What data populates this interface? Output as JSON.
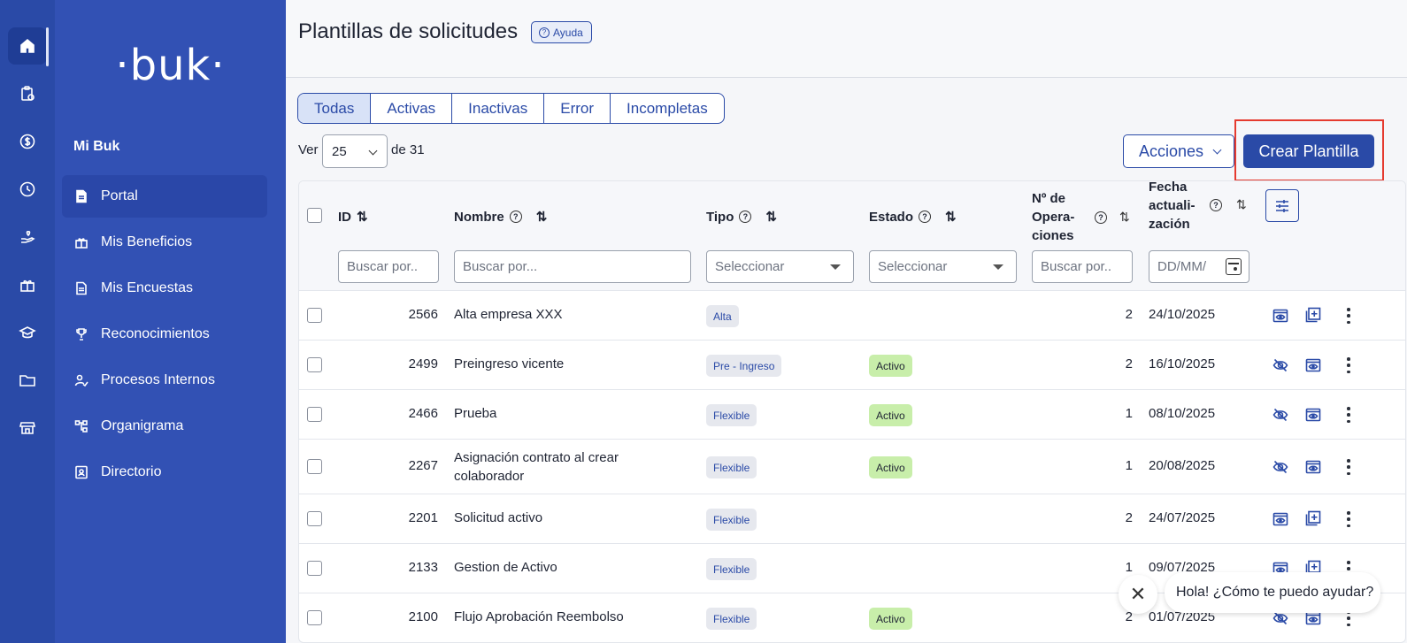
{
  "rail": {
    "items": [
      {
        "icon": "home-icon",
        "active": true
      },
      {
        "icon": "clipboard-clock-icon"
      },
      {
        "icon": "dollar-circle-icon"
      },
      {
        "icon": "clock-icon"
      },
      {
        "icon": "hand-heart-icon"
      },
      {
        "icon": "gift-icon"
      },
      {
        "icon": "graduation-cap-icon"
      },
      {
        "icon": "folder-icon"
      },
      {
        "icon": "store-icon"
      }
    ]
  },
  "sidebar": {
    "logo": "·buk·",
    "section_title": "Mi Buk",
    "items": [
      {
        "label": "Portal",
        "icon": "document-icon",
        "active": true
      },
      {
        "label": "Mis Beneficios",
        "icon": "gift-icon"
      },
      {
        "label": "Mis Encuestas",
        "icon": "survey-icon"
      },
      {
        "label": "Reconocimientos",
        "icon": "trophy-icon"
      },
      {
        "label": "Procesos Internos",
        "icon": "user-check-icon"
      },
      {
        "label": "Organigrama",
        "icon": "org-chart-icon"
      },
      {
        "label": "Directorio",
        "icon": "contact-card-icon"
      }
    ]
  },
  "header": {
    "title": "Plantillas de solicitudes",
    "help_label": "Ayuda"
  },
  "tabs": [
    {
      "label": "Todas",
      "active": true
    },
    {
      "label": "Activas"
    },
    {
      "label": "Inactivas"
    },
    {
      "label": "Error"
    },
    {
      "label": "Incompletas"
    }
  ],
  "pagination": {
    "ver_label": "Ver",
    "per_page": "25",
    "total_label": "de 31"
  },
  "toolbar": {
    "actions_label": "Acciones",
    "create_label": "Crear Plantilla"
  },
  "table": {
    "columns": {
      "id": "ID",
      "nombre": "Nombre",
      "tipo": "Tipo",
      "estado": "Estado",
      "operaciones": [
        "Nº de",
        "Opera-",
        "ciones"
      ],
      "fecha": [
        "Fecha",
        "actuali-",
        "zación"
      ]
    },
    "filters": {
      "id_placeholder": "Buscar por..",
      "nombre_placeholder": "Buscar por...",
      "tipo_placeholder": "Seleccionar",
      "estado_placeholder": "Seleccionar",
      "operaciones_placeholder": "Buscar por..",
      "fecha_placeholder": "DD/MM/"
    },
    "rows": [
      {
        "id": "2566",
        "nombre": "Alta empresa XXX",
        "tipo": "Alta",
        "estado": "",
        "operaciones": "2",
        "fecha": "24/10/2025",
        "icons": [
          "eye-window-icon",
          "add-square-icon"
        ]
      },
      {
        "id": "2499",
        "nombre": "Preingreso vicente",
        "tipo": "Pre - Ingreso",
        "estado": "Activo",
        "operaciones": "2",
        "fecha": "16/10/2025",
        "icons": [
          "eye-off-icon",
          "eye-window-icon"
        ]
      },
      {
        "id": "2466",
        "nombre": "Prueba",
        "tipo": "Flexible",
        "estado": "Activo",
        "operaciones": "1",
        "fecha": "08/10/2025",
        "icons": [
          "eye-off-icon",
          "eye-window-icon"
        ]
      },
      {
        "id": "2267",
        "nombre": "Asignación contrato al crear colaborador",
        "tipo": "Flexible",
        "estado": "Activo",
        "operaciones": "1",
        "fecha": "20/08/2025",
        "icons": [
          "eye-off-icon",
          "eye-window-icon"
        ]
      },
      {
        "id": "2201",
        "nombre": "Solicitud activo",
        "tipo": "Flexible",
        "estado": "",
        "operaciones": "2",
        "fecha": "24/07/2025",
        "icons": [
          "eye-window-icon",
          "add-square-icon"
        ]
      },
      {
        "id": "2133",
        "nombre": "Gestion de Activo",
        "tipo": "Flexible",
        "estado": "",
        "operaciones": "1",
        "fecha": "09/07/2025",
        "icons": [
          "eye-window-icon",
          "add-square-icon"
        ]
      },
      {
        "id": "2100",
        "nombre": "Flujo Aprobación Reembolso",
        "tipo": "Flexible",
        "estado": "Activo",
        "operaciones": "2",
        "fecha": "01/07/2025",
        "icons": [
          "eye-off-icon",
          "eye-window-icon"
        ]
      }
    ]
  },
  "chat": {
    "message": "Hola! ¿Cómo te puedo ayudar?"
  },
  "colors": {
    "primary": "#2a4aa7",
    "sidebar": "#3251b4",
    "active_badge": "#c8eeaa",
    "highlight": "#e53a2f"
  }
}
